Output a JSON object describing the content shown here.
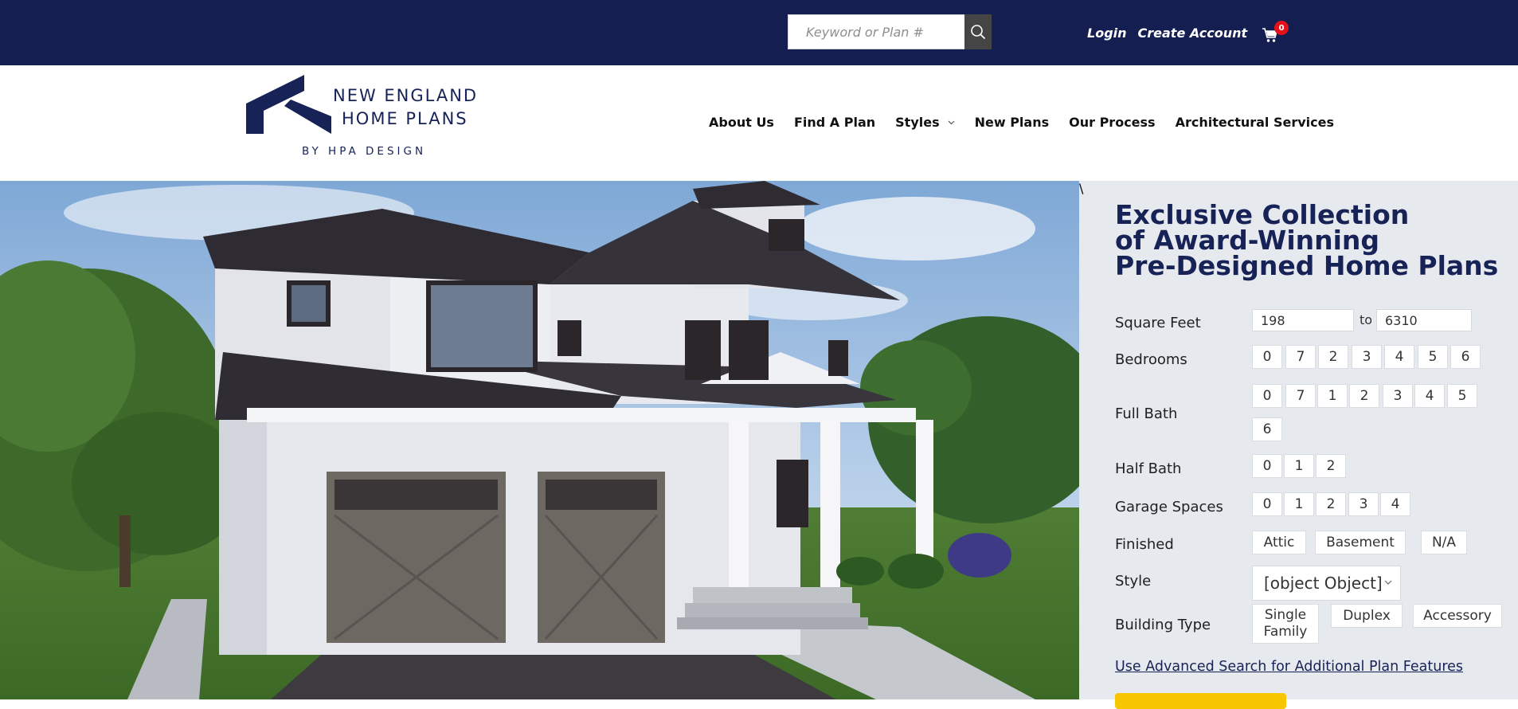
{
  "topbar": {
    "search_placeholder": "Keyword or Plan #",
    "search_icon": "search-icon",
    "login": "Login",
    "create_account": "Create Account",
    "cart_icon": "cart-icon",
    "cart_count": "0",
    "bg_color": "#141e50",
    "badge_color": "#e3121a"
  },
  "logo": {
    "line1": "NEW ENGLAND",
    "line2": "HOME PLANS",
    "tagline": "BY HPA DESIGN",
    "color": "#172256"
  },
  "nav": {
    "items": [
      {
        "label": "About Us"
      },
      {
        "label": "Find A Plan"
      },
      {
        "label": "Styles",
        "icon": "chevron-down-icon"
      },
      {
        "label": "New Plans"
      },
      {
        "label": "Our Process"
      },
      {
        "label": "Architectural Services"
      }
    ]
  },
  "panel": {
    "headline": [
      "Exclusive Collection",
      "of Award-Winning",
      "Pre-Designed Home Plans"
    ],
    "square_feet": {
      "label": "Square Feet",
      "min": "198",
      "to": "to",
      "max": "6310"
    },
    "bedrooms": {
      "label": "Bedrooms",
      "options": [
        "0",
        "7",
        "2",
        "3",
        "4",
        "5",
        "6"
      ]
    },
    "full_bath": {
      "label": "Full Bath",
      "options": [
        "0",
        "7",
        "1",
        "2",
        "3",
        "4",
        "5",
        "6"
      ]
    },
    "half_bath": {
      "label": "Half Bath",
      "options": [
        "0",
        "1",
        "2"
      ]
    },
    "garage_spaces": {
      "label": "Garage Spaces",
      "options": [
        "0",
        "1",
        "2",
        "3",
        "4"
      ]
    },
    "finished": {
      "label": "Finished",
      "options": [
        "Attic",
        "Basement",
        "N/A"
      ]
    },
    "style": {
      "label": "Style",
      "value": "[object Object]",
      "icon": "chevron-down-icon"
    },
    "building_type": {
      "label": "Building Type",
      "options": [
        "Single Family",
        "Duplex",
        "Accessory"
      ],
      "first_line1": "Single",
      "first_line2": "Family"
    },
    "advanced_link": "Use Advanced Search for Additional Plan Features",
    "accent_color": "#f7c600",
    "bg_color": "#e6eaee"
  }
}
